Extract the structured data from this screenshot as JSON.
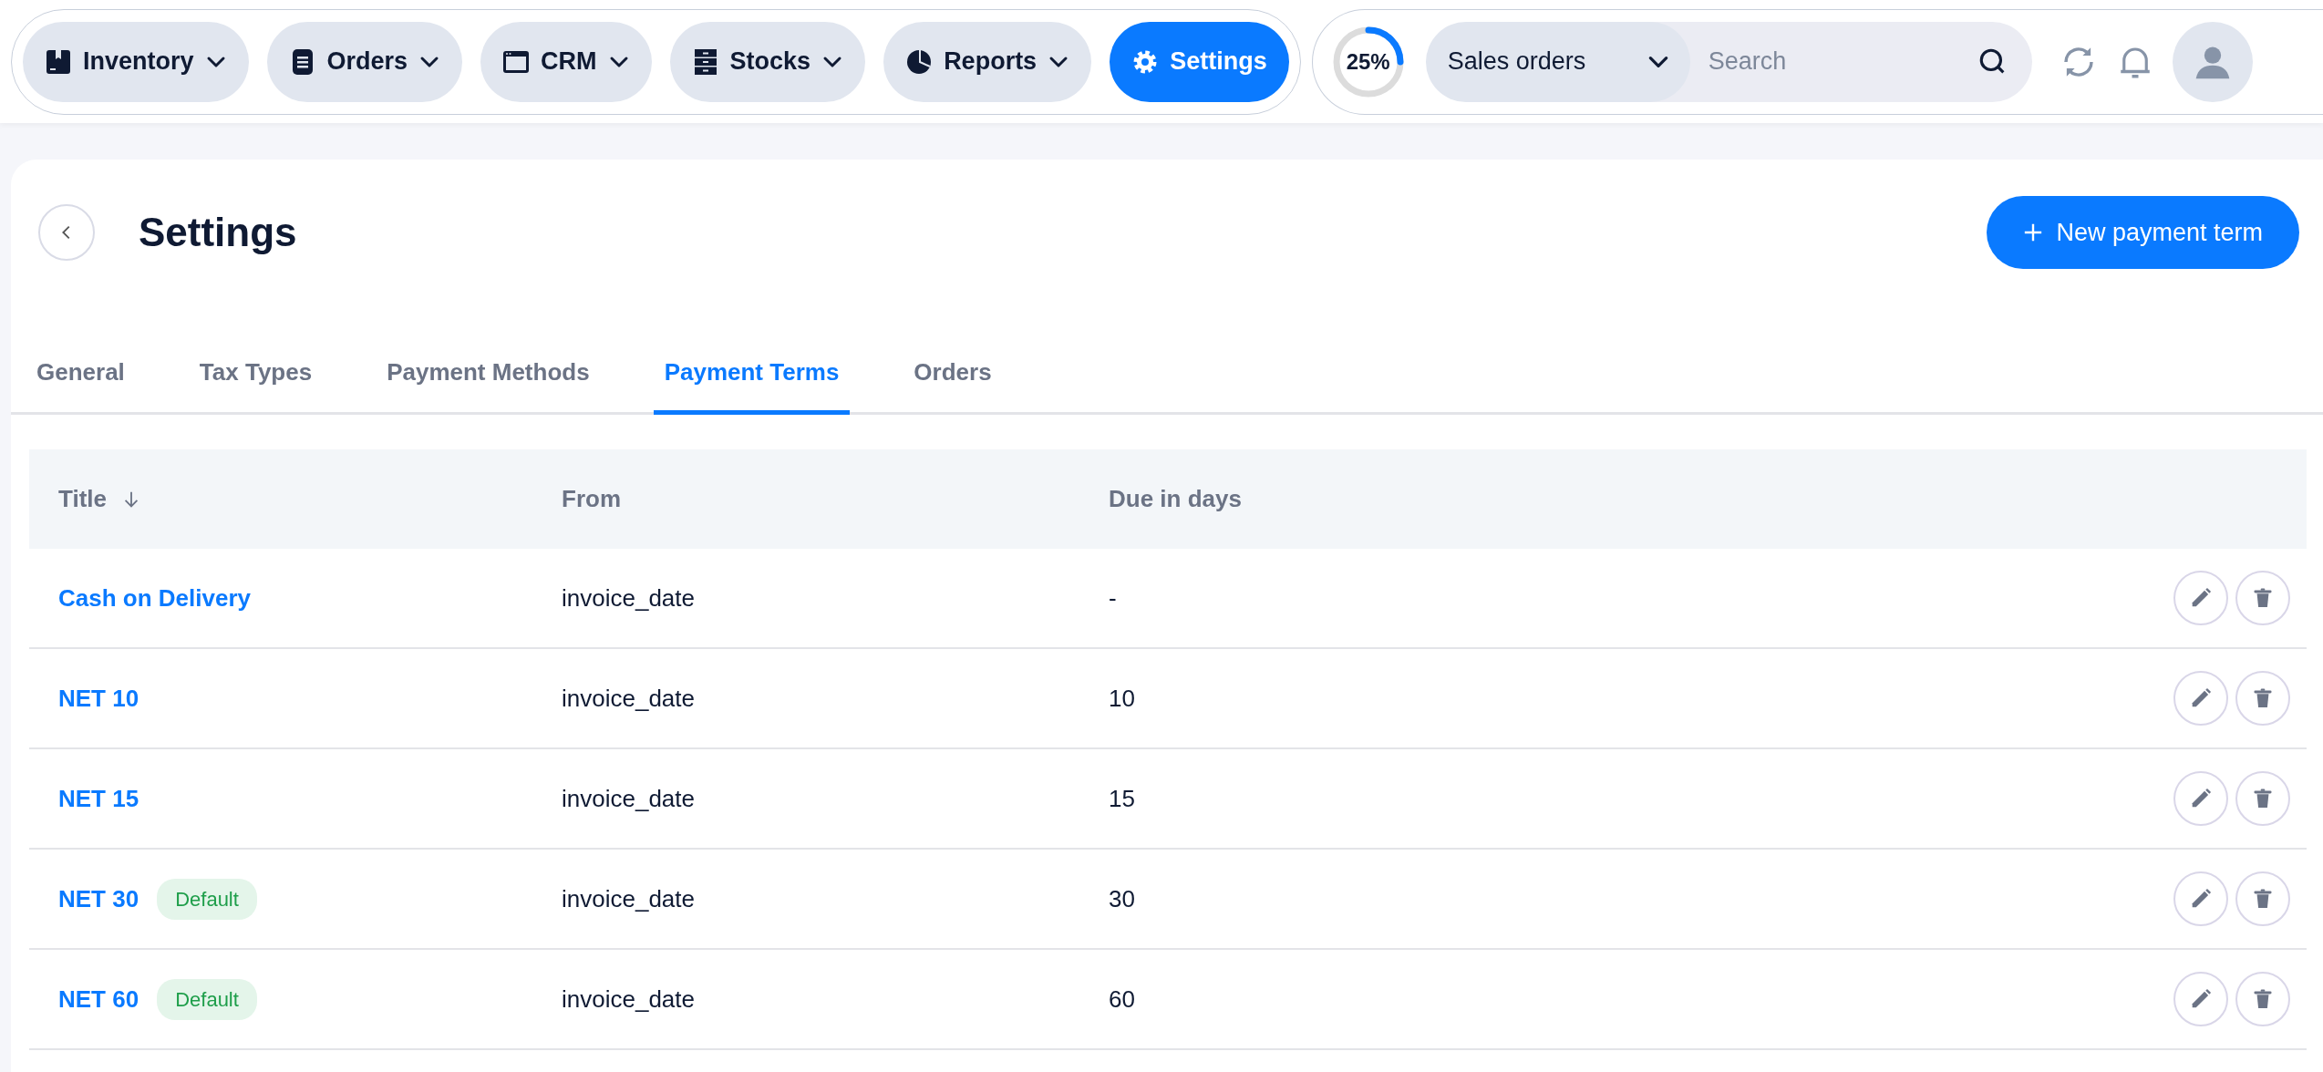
{
  "nav": {
    "items": [
      {
        "label": "Inventory",
        "dropdown": true,
        "selected": false
      },
      {
        "label": "Orders",
        "dropdown": true,
        "selected": false
      },
      {
        "label": "CRM",
        "dropdown": true,
        "selected": false
      },
      {
        "label": "Stocks",
        "dropdown": true,
        "selected": false
      },
      {
        "label": "Reports",
        "dropdown": true,
        "selected": false
      },
      {
        "label": "Settings",
        "dropdown": false,
        "selected": true
      }
    ]
  },
  "progress": {
    "label": "25%",
    "level": 0.25
  },
  "search": {
    "scope": "Sales orders",
    "placeholder": "Search"
  },
  "page": {
    "title": "Settings",
    "primary_button": "New payment term"
  },
  "tabs": [
    {
      "label": "General",
      "selected": false
    },
    {
      "label": "Tax Types",
      "selected": false
    },
    {
      "label": "Payment Methods",
      "selected": false
    },
    {
      "label": "Payment Terms",
      "selected": true
    },
    {
      "label": "Orders",
      "selected": false
    }
  ],
  "table": {
    "columns": [
      {
        "label": "Title",
        "sorted": true
      },
      {
        "label": "From",
        "sorted": false
      },
      {
        "label": "Due in days",
        "sorted": false
      }
    ],
    "rows": [
      {
        "title": "Cash on Delivery",
        "from": "invoice_date",
        "due": "-"
      },
      {
        "title": "NET 10",
        "from": "invoice_date",
        "due": "10"
      },
      {
        "title": "NET 15",
        "from": "invoice_date",
        "due": "15"
      },
      {
        "title": "NET 30",
        "badge": "Default",
        "from": "invoice_date",
        "due": "30"
      },
      {
        "title": "NET 60",
        "badge": "Default",
        "from": "invoice_date",
        "due": "60"
      }
    ]
  }
}
